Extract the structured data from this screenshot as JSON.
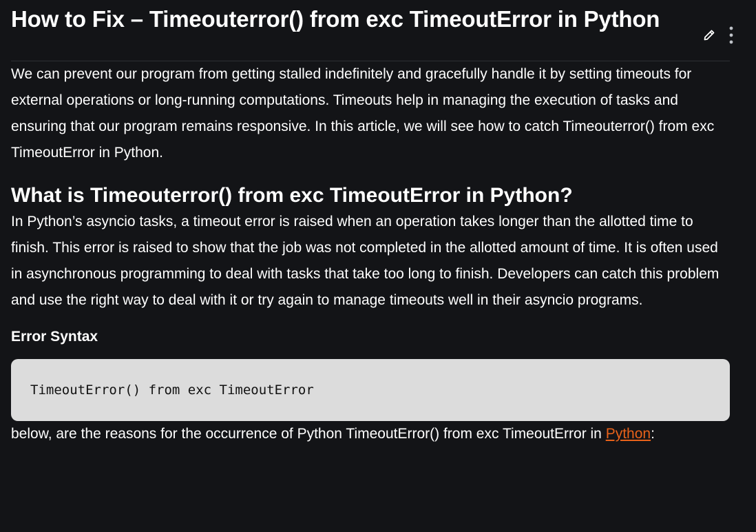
{
  "article": {
    "title": "How to Fix – Timeouterror() from exc TimeoutError in Python",
    "intro": "We can prevent our program from getting stalled indefinitely and gracefully handle it by setting timeouts for external operations or long-running computations. Timeouts help in managing the execution of tasks and ensuring that our program remains responsive. In this article, we will see how to catch Timeouterror() from exc TimeoutError in Python.",
    "section_heading": "What is Timeouterror() from exc TimeoutError in Python?",
    "section_body": "In Python’s asyncio tasks, a timeout error is raised when an operation takes longer than the allotted time to finish. This error is raised to show that the job was not completed in the allotted amount of time. It is often used in asynchronous programming to deal with tasks that take too long to finish. Developers can catch this problem and use the right way to deal with it or try again to manage timeouts well in their asyncio programs.",
    "syntax_heading": "Error Syntax",
    "code": "TimeoutError() from exc TimeoutError",
    "reasons_prefix": "below, are the reasons for the occurrence of Python TimeoutError() from exc TimeoutError in ",
    "reasons_link": "Python",
    "reasons_suffix": ":"
  },
  "actions": {
    "edit_icon": "pencil-icon",
    "more_icon": "vertical-dots-icon"
  },
  "colors": {
    "background": "#131417",
    "text": "#ffffff",
    "code_background": "#dcdcdc",
    "link": "#e8621a"
  }
}
